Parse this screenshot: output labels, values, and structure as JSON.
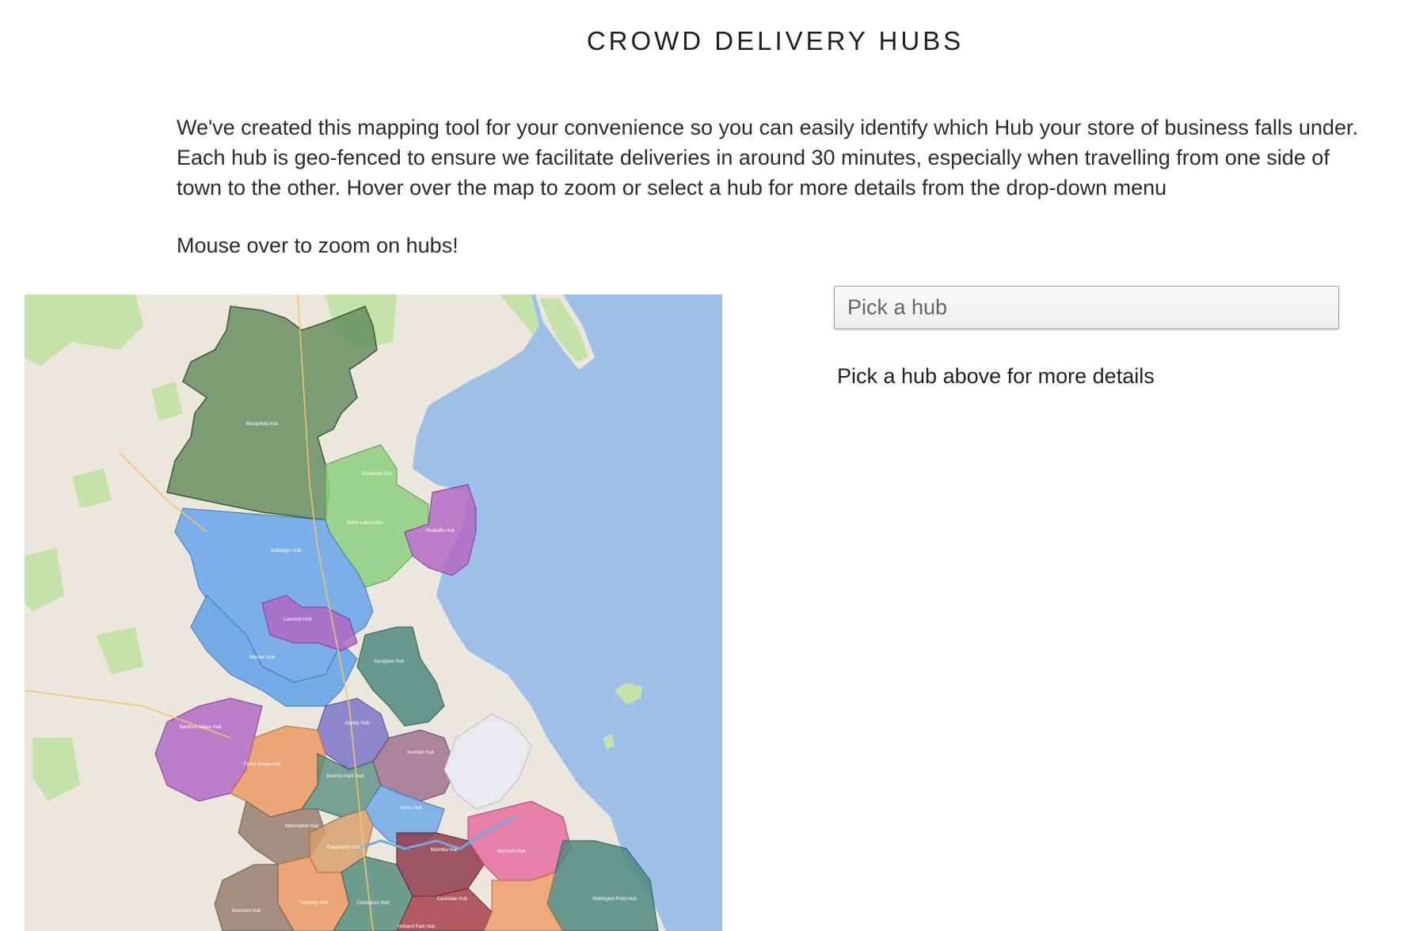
{
  "header": {
    "title": "CROWD DELIVERY HUBS"
  },
  "intro": {
    "paragraph": "We've created this mapping tool for your convenience so you can easily identify which Hub your store of business falls under. Each hub is geo-fenced to ensure we facilitate deliveries in around 30 minutes, especially when travelling from one side of town to the other. Hover over the map to zoom or select a hub for more details from the drop-down menu",
    "mouse_over": "Mouse over to zoom on hubs!"
  },
  "hub_picker": {
    "selected_value": "Pick a hub",
    "details_text": "Pick a hub above for more details"
  },
  "map": {
    "hub_labels": [
      "Morayfield Hub",
      "Deception Bay",
      "North Lakes Hub",
      "Redcliffe Hub",
      "Kallangur Hub",
      "Lawnton Hub",
      "Warner Hub",
      "Sandgate Hub",
      "Aspley Hub",
      "Samford Valley Hub",
      "Ferny Grove Hub",
      "Everton Park Hub",
      "Nundah Hub",
      "Ascot Hub",
      "Newmarket Hub",
      "Paddington Hub",
      "Bulimba Hub",
      "Wynnum Hub",
      "Carindale Hub",
      "Wellington Point Hub",
      "Toowong Hub",
      "Kenmore Hub",
      "Coorparoo Hub",
      "Holland Park Hub"
    ],
    "colors": {
      "water": "#9cc0e7",
      "land": "#ebe7dc",
      "park": "#c5e3a8",
      "north_green": "#5f8a5a",
      "light_green": "#8ecf7e",
      "blue": "#6ea9e8",
      "purple": "#b368c4",
      "orange": "#ec9a63",
      "brown": "#9c8474",
      "teal": "#4f8a7c",
      "pink": "#e66d9e",
      "darkred": "#8f3c4c"
    }
  }
}
